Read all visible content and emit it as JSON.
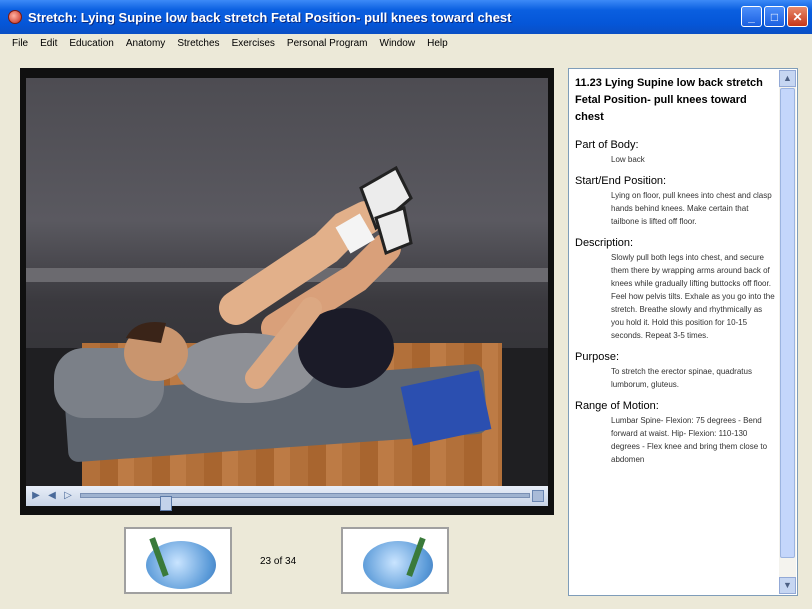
{
  "window": {
    "title": "Stretch: Lying Supine low back stretch Fetal Position- pull knees toward chest",
    "icon": "app-icon",
    "controls": [
      "minimize",
      "maximize",
      "close"
    ]
  },
  "menu": [
    "File",
    "Edit",
    "Education",
    "Anatomy",
    "Stretches",
    "Exercises",
    "Personal Program",
    "Window",
    "Help"
  ],
  "player": {
    "controls": [
      "play-icon",
      "rewind-icon",
      "forward-icon"
    ],
    "progress": 0.18
  },
  "navigation": {
    "counter": "23 of 34"
  },
  "info": {
    "title": "11.23 Lying Supine low back stretch Fetal Position- pull knees toward chest",
    "sections": [
      {
        "label": "Part of Body:",
        "text": "Low back"
      },
      {
        "label": "Start/End Position:",
        "text": "Lying on floor, pull knees into chest and clasp hands behind knees. Make certain that tailbone is lifted off floor."
      },
      {
        "label": "Description:",
        "text": "Slowly pull both legs into chest, and secure them there by wrapping arms around back of knees while gradually lifting buttocks off floor. Feel how pelvis tilts. Exhale as you go into the stretch. Breathe slowly and rhythmically as you hold it. Hold this position for 10-15 seconds. Repeat 3-5 times."
      },
      {
        "label": "Purpose:",
        "text": "To stretch the erector spinae, quadratus lumborum, gluteus."
      },
      {
        "label": "Range of Motion:",
        "text": "Lumbar Spine- Flexion: 75 degrees - Bend forward at waist. Hip- Flexion: 110-130 degrees - Flex knee and bring them close to abdomen"
      }
    ]
  }
}
